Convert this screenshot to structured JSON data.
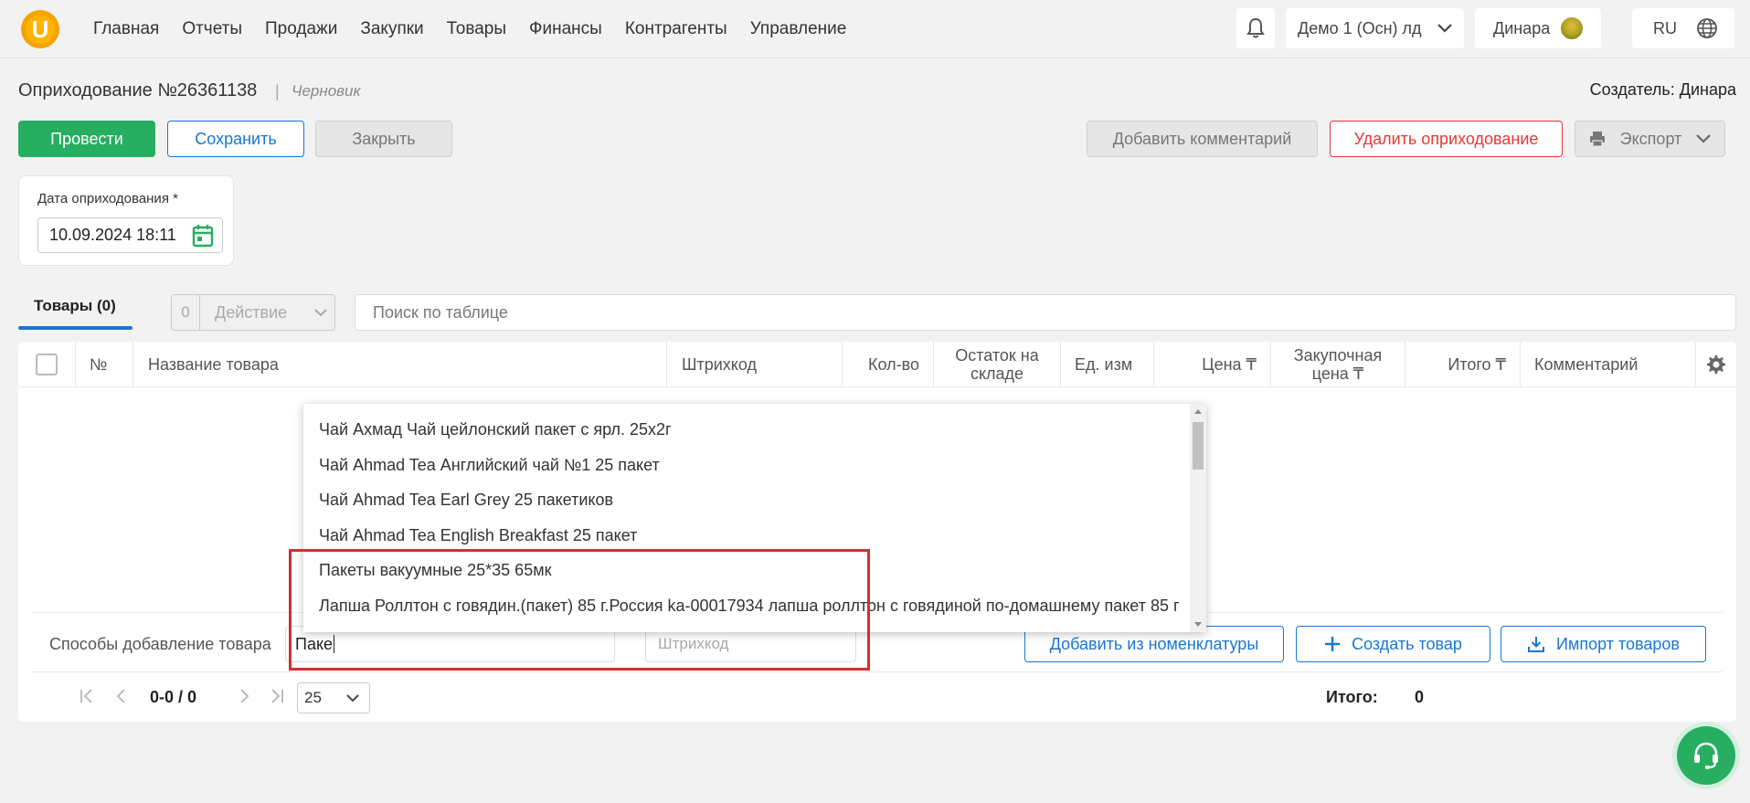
{
  "app": {
    "logo_letter": "U",
    "nav": [
      "Главная",
      "Отчеты",
      "Продажи",
      "Закупки",
      "Товары",
      "Финансы",
      "Контрагенты",
      "Управление"
    ],
    "company": "Демо 1 (Осн) лд",
    "user": "Динара",
    "language": "RU"
  },
  "doc": {
    "title": "Оприходование №26361138",
    "separator": "|",
    "status": "Черновик",
    "creator": "Создатель: Динара"
  },
  "buttons": {
    "post": "Провести",
    "save": "Сохранить",
    "close": "Закрыть",
    "add_comment": "Добавить комментарий",
    "delete": "Удалить оприходование",
    "export": "Экспорт"
  },
  "date_field": {
    "label": "Дата оприходования *",
    "value": "10.09.2024 18:11"
  },
  "tabs": {
    "goods": "Товары  (0)"
  },
  "action": {
    "count": "0",
    "label": "Действие"
  },
  "search": {
    "placeholder": "Поиск по таблице"
  },
  "table": {
    "columns": {
      "num": "№",
      "name": "Название товара",
      "barcode": "Штрихкод",
      "qty": "Кол-во",
      "stock": "Остаток на складе",
      "unit": "Ед. изм",
      "price": "Цена ₸",
      "purchase": "Закупочная цена ₸",
      "total": "Итого ₸",
      "comment": "Комментарий"
    }
  },
  "add_row": {
    "label": "Способы добавление товара",
    "name_value": "Паке",
    "barcode_placeholder": "Штрихкод",
    "from_nomenclature": "Добавить из номенклатуры",
    "create": "Создать товар",
    "import": "Импорт товаров"
  },
  "pager": {
    "range": "0-0 / 0",
    "page_size": "25",
    "total_label": "Итого:",
    "total_value": "0"
  },
  "dropdown": {
    "items": [
      "Чай Ахмад Чай цейлонский пакет с ярл. 25х2г",
      "Чай Ahmad Tea Английский чай №1 25 пакет",
      "Чай Ahmad Tea Earl Grey 25 пакетиков",
      "Чай Ahmad Tea English Breakfast 25 пакет",
      "Пакеты вакуумные 25*35 65мк",
      "Лапша Роллтон с говядин.(пакет) 85 г.Россия ka-00017934 лапша роллтон с говядиной по-домашнему пакет 85 г"
    ]
  },
  "colors": {
    "accent": "#1976d2",
    "success": "#27ae60",
    "danger": "#e53935",
    "highlight": "#d32f2f"
  }
}
